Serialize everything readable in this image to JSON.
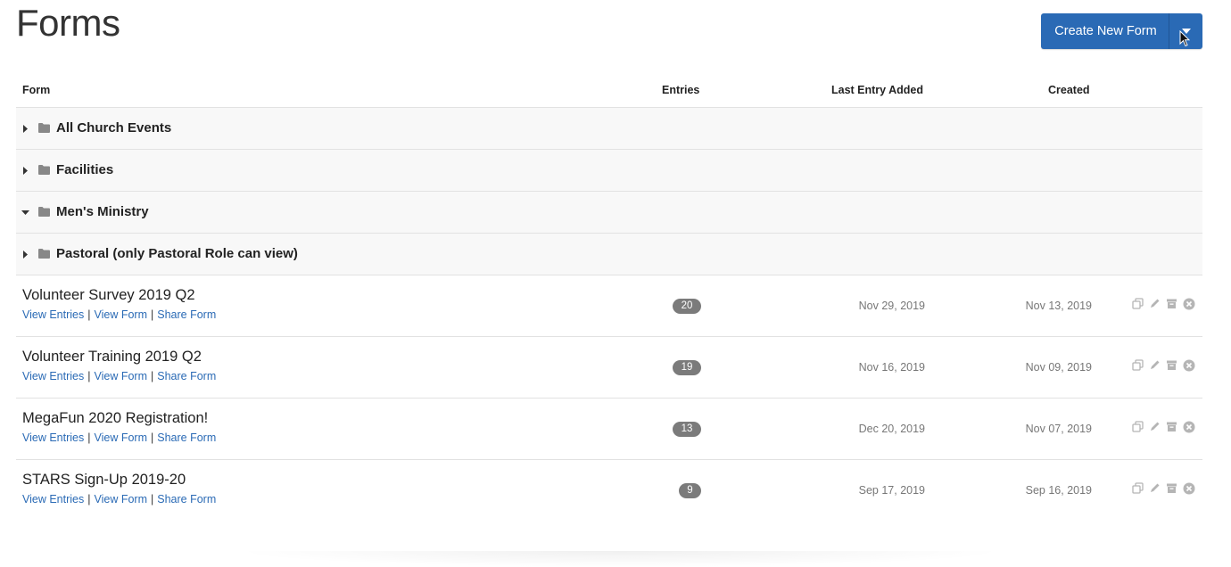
{
  "page": {
    "title": "Forms"
  },
  "create_button": {
    "label": "Create New Form"
  },
  "table": {
    "headers": {
      "form": "Form",
      "entries": "Entries",
      "last_entry": "Last Entry Added",
      "created": "Created"
    },
    "folders": [
      {
        "name": "All Church Events",
        "expanded": false
      },
      {
        "name": "Facilities",
        "expanded": false
      },
      {
        "name": "Men's Ministry",
        "expanded": true
      },
      {
        "name": "Pastoral (only Pastoral Role can view)",
        "expanded": false
      }
    ],
    "forms": [
      {
        "title": "Volunteer Survey 2019 Q2",
        "entries": "20",
        "last_entry": "Nov 29, 2019",
        "created": "Nov 13, 2019"
      },
      {
        "title": "Volunteer Training 2019 Q2",
        "entries": "19",
        "last_entry": "Nov 16, 2019",
        "created": "Nov 09, 2019"
      },
      {
        "title": "MegaFun 2020 Registration!",
        "entries": "13",
        "last_entry": "Dec 20, 2019",
        "created": "Nov 07, 2019"
      },
      {
        "title": "STARS Sign-Up 2019-20",
        "entries": "9",
        "last_entry": "Sep 17, 2019",
        "created": "Sep 16, 2019"
      }
    ],
    "row_links": {
      "view_entries": "View Entries",
      "view_form": "View Form",
      "share_form": "Share Form",
      "separator": "|"
    }
  },
  "icons": {
    "expand": "caret-right-icon",
    "collapse": "caret-down-icon",
    "folder": "folder-icon",
    "duplicate": "copy-icon",
    "edit": "pencil-icon",
    "archive": "archive-icon",
    "delete": "close-circle-icon",
    "dropdown": "chevron-down-icon",
    "cursor": "mouse-pointer-icon"
  },
  "colors": {
    "primary": "#2a6ab5",
    "link": "#2a6ab5",
    "badge": "#7b7b7b",
    "folder_row_bg": "#f8f8f8",
    "icon_gray": "#b5b5b5"
  }
}
